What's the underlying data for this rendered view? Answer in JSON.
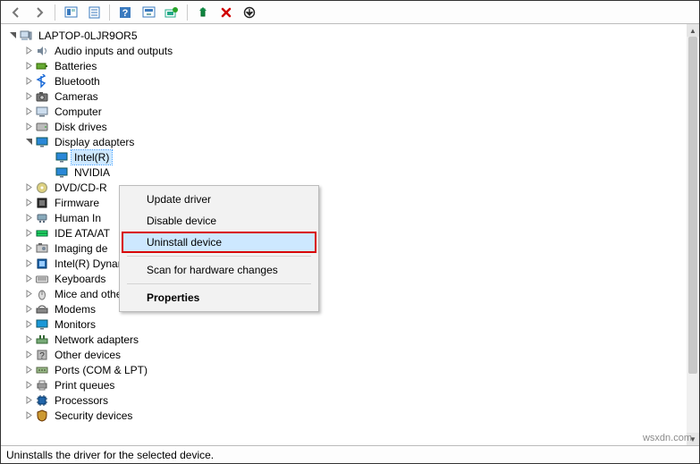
{
  "root_label": "LAPTOP-0LJR9OR5",
  "categories": [
    {
      "label": "Audio inputs and outputs",
      "icon": "audio"
    },
    {
      "label": "Batteries",
      "icon": "battery"
    },
    {
      "label": "Bluetooth",
      "icon": "bluetooth"
    },
    {
      "label": "Cameras",
      "icon": "camera"
    },
    {
      "label": "Computer",
      "icon": "computer"
    },
    {
      "label": "Disk drives",
      "icon": "disk"
    },
    {
      "label": "Display adapters",
      "icon": "display",
      "expanded": true,
      "children": [
        {
          "label": "Intel(R)",
          "icon": "display",
          "selected": true
        },
        {
          "label": "NVIDIA",
          "icon": "display"
        }
      ]
    },
    {
      "label": "DVD/CD-R",
      "icon": "optical",
      "truncated": true
    },
    {
      "label": "Firmware",
      "icon": "firmware",
      "truncated": true
    },
    {
      "label": "Human In",
      "icon": "hid",
      "truncated": true
    },
    {
      "label": "IDE ATA/AT",
      "icon": "ide",
      "truncated": true
    },
    {
      "label": "Imaging de",
      "icon": "imaging",
      "truncated": true
    },
    {
      "label": "Intel(R) Dynamic Platform and Thermal Framework",
      "icon": "intel"
    },
    {
      "label": "Keyboards",
      "icon": "keyboard"
    },
    {
      "label": "Mice and other pointing devices",
      "icon": "mouse"
    },
    {
      "label": "Modems",
      "icon": "modem"
    },
    {
      "label": "Monitors",
      "icon": "monitor"
    },
    {
      "label": "Network adapters",
      "icon": "network"
    },
    {
      "label": "Other devices",
      "icon": "other"
    },
    {
      "label": "Ports (COM & LPT)",
      "icon": "port"
    },
    {
      "label": "Print queues",
      "icon": "printer"
    },
    {
      "label": "Processors",
      "icon": "cpu"
    },
    {
      "label": "Security devices",
      "icon": "security",
      "partial": true
    }
  ],
  "context_menu": {
    "items": [
      {
        "label": "Update driver"
      },
      {
        "label": "Disable device"
      },
      {
        "label": "Uninstall device",
        "highlighted": true,
        "callout": true
      },
      {
        "separator": true
      },
      {
        "label": "Scan for hardware changes"
      },
      {
        "separator": true
      },
      {
        "label": "Properties",
        "bold": true
      }
    ]
  },
  "status_text": "Uninstalls the driver for the selected device.",
  "watermark": "wsxdn.com"
}
